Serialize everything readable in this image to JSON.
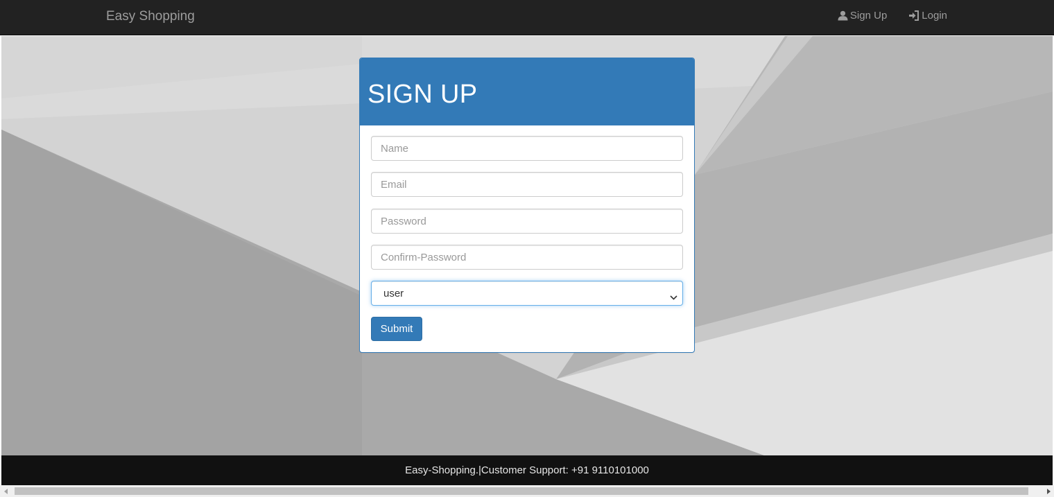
{
  "navbar": {
    "brand": "Easy Shopping",
    "links": [
      {
        "label": "Sign Up",
        "icon": "user-icon"
      },
      {
        "label": "Login",
        "icon": "login-icon"
      }
    ]
  },
  "panel": {
    "title": "SIGN UP",
    "fields": {
      "name_placeholder": "Name",
      "email_placeholder": "Email",
      "password_placeholder": "Password",
      "confirm_password_placeholder": "Confirm-Password"
    },
    "role_select": {
      "selected": "user"
    },
    "submit_label": "Submit"
  },
  "footer": {
    "text": "Easy-Shopping.|Customer Support: +91 9110101000"
  },
  "colors": {
    "navbar_bg": "#222222",
    "primary": "#337ab7",
    "footer_bg": "#111111"
  }
}
